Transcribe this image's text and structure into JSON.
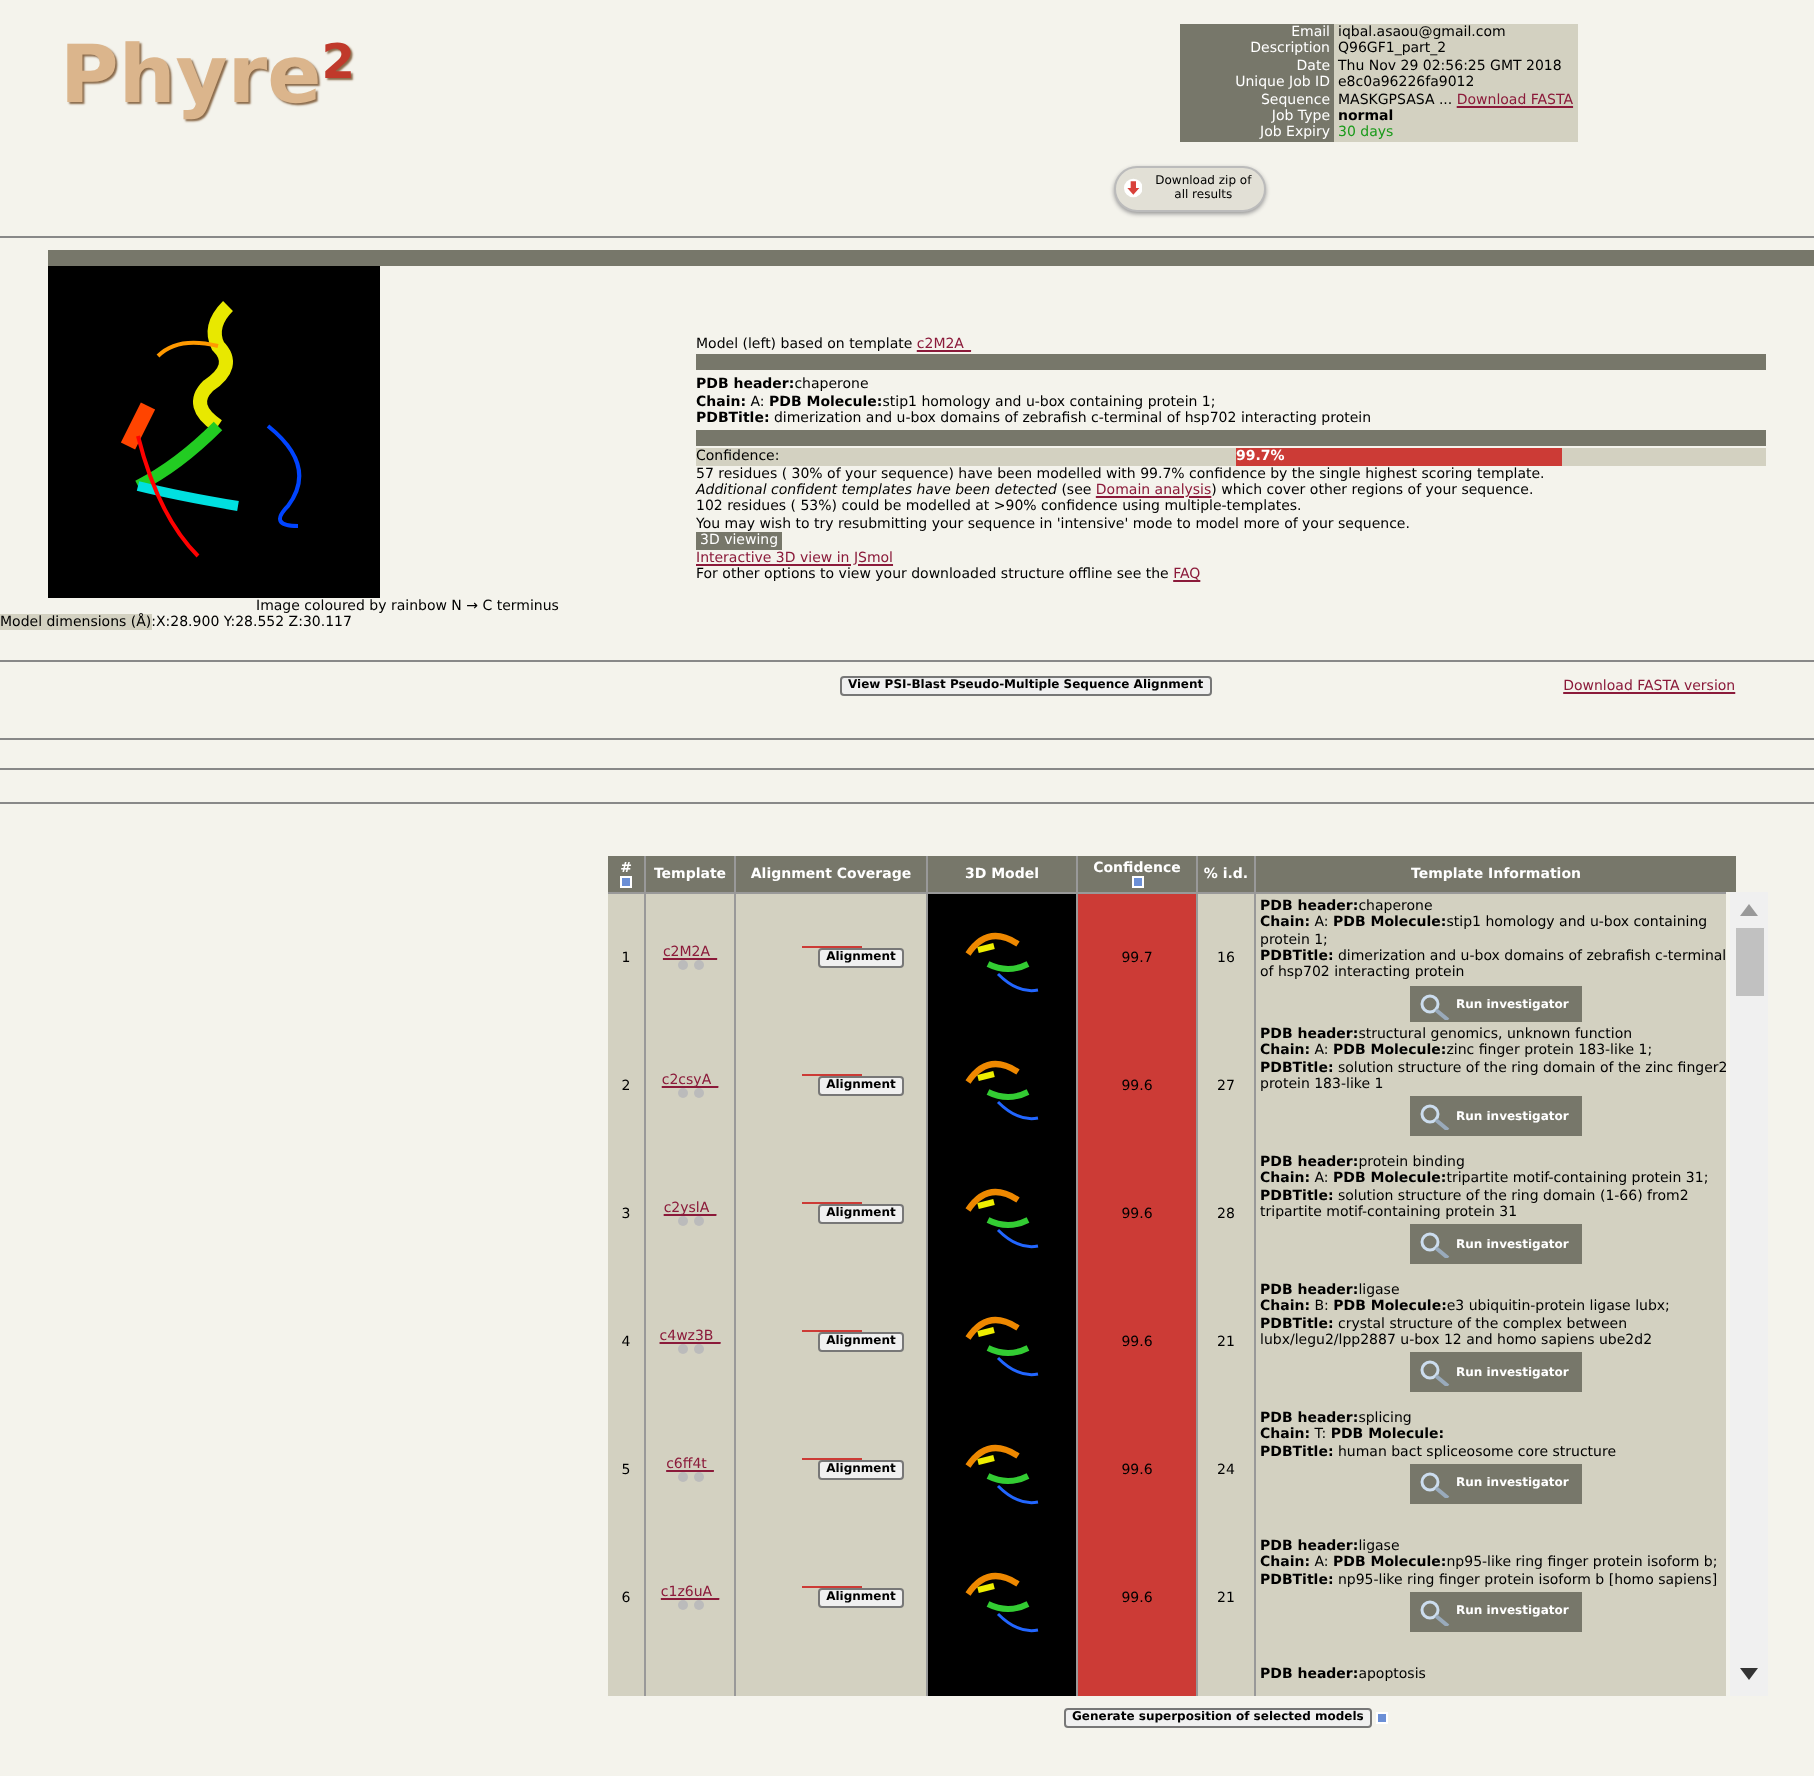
{
  "logo": "Phyre$^{2}$",
  "job_info": [
    {
      "label": "Email",
      "value": "iqbal.asaou@gmail.com",
      "kind": "text"
    },
    {
      "label": "Description",
      "value": "Q96GF1_part_2",
      "kind": "text"
    },
    {
      "label": "Date",
      "value": "Thu Nov 29 02:56:25 GMT 2018",
      "kind": "text"
    },
    {
      "label": "Unique Job ID",
      "value": "e8c0a96226fa9012",
      "kind": "text"
    },
    {
      "label": "Sequence",
      "value": "MASKGPSASA ... ",
      "link": "Download FASTA",
      "kind": "link"
    },
    {
      "label": "Job Type",
      "value": "normal",
      "kind": "bold"
    },
    {
      "label": "Job Expiry",
      "value": "30 days",
      "kind": "good"
    }
  ],
  "download_zip_button": "Download zip of all results",
  "summary": {
    "template_line": "Model (left) based on template ",
    "template_link": "c2M2A_",
    "pdb_header": "**PDB header:**chaperone",
    "chain": "**Chain:** A: **PDB Molecule:**stip1 homology and u-box containing protein 1;",
    "title": "**PDBTitle:** dimerization and u-box domains of zebrafish c-terminal of hsp702 interacting protein",
    "confidence_label": "Confidence:",
    "confidence": "99.7%",
    "level": 0.997,
    "residues": "57 residues ( 30% of your sequence) have been modelled with 99.7% confidence by the single highest scoring template.",
    "additional_before": "*Additional confident templates have been detected* (see ",
    "additional_link": "Domain analysis",
    "additional_after": ") which cover other regions of your sequence.",
    "multi": "102 residues ( 53%) could be modelled at >90% confidence using multiple-templates.",
    "intensive": "You may wish to try resubmitting your sequence in 'intensive' mode to model more of your sequence.",
    "viewing_label": "3D viewing",
    "jsmol_link": "Interactive 3D view in JSmol",
    "offline_text": "For other options to view your downloaded structure offline see the ",
    "faq_link": "FAQ",
    "image_caption": "Image coloured by rainbow N → C terminus",
    "dimensions_label": "Model dimensions (Å)",
    "dimensions": ":X:28.900 Y:28.552 Z:30.117"
  },
  "alignment_button": "View PSI-Blast Pseudo-Multiple Sequence Alignment",
  "fasta_link": "Download FASTA version",
  "table": {
    "columns": [
      "#",
      "Template",
      "Alignment Coverage",
      "3D Model",
      "Confidence",
      "% i.d.",
      "Template Information"
    ],
    "rows": [
      {
        "num": "1",
        "template": "c2M2A_",
        "alignment_label": "Alignment",
        "investigator_label": "Run investigator",
        "confidence": "99.7",
        "identity": "16",
        "pdb_header": "**PDB header:**chaperone",
        "chain": "**Chain:** A: **PDB Molecule:**stip1 homology and u-box containing protein 1;",
        "title": "**PDBTitle:** dimerization and u-box domains of zebrafish c-terminal of hsp702 interacting protein"
      },
      {
        "num": "2",
        "template": "c2csyA_",
        "alignment_label": "Alignment",
        "investigator_label": "Run investigator",
        "confidence": "99.6",
        "identity": "27",
        "pdb_header": "**PDB header:**structural genomics, unknown function",
        "chain": "**Chain:** A: **PDB Molecule:**zinc finger protein 183-like 1;",
        "title": "**PDBTitle:** solution structure of the ring domain of the zinc finger2 protein 183-like 1"
      },
      {
        "num": "3",
        "template": "c2yslA_",
        "alignment_label": "Alignment",
        "investigator_label": "Run investigator",
        "confidence": "99.6",
        "identity": "28",
        "pdb_header": "**PDB header:**protein binding",
        "chain": "**Chain:** A: **PDB Molecule:**tripartite motif-containing protein 31;",
        "title": "**PDBTitle:** solution structure of the ring domain (1-66) from2 tripartite motif-containing protein 31"
      },
      {
        "num": "4",
        "template": "c4wz3B_",
        "alignment_label": "Alignment",
        "investigator_label": "Run investigator",
        "confidence": "99.6",
        "identity": "21",
        "pdb_header": "**PDB header:**ligase",
        "chain": "**Chain:** B: **PDB Molecule:**e3 ubiquitin-protein ligase lubx;",
        "title": "**PDBTitle:** crystal structure of the complex between lubx/legu2/lpp2887 u-box 12 and homo sapiens ube2d2"
      },
      {
        "num": "5",
        "template": "c6ff4t_",
        "alignment_label": "Alignment",
        "investigator_label": "Run investigator",
        "confidence": "99.6",
        "identity": "24",
        "pdb_header": "**PDB header:**splicing",
        "chain": "**Chain:** T: **PDB Molecule:**",
        "title": "**PDBTitle:** human bact spliceosome core structure"
      },
      {
        "num": "6",
        "template": "c1z6uA_",
        "alignment_label": "Alignment",
        "investigator_label": "Run investigator",
        "confidence": "99.6",
        "identity": "21",
        "pdb_header": "**PDB header:**ligase",
        "chain": "**Chain:** A: **PDB Molecule:**np95-like ring finger protein isoform b;",
        "title": "**PDBTitle:** np95-like ring finger protein isoform b [homo sapiens]"
      },
      {
        "pdb_header": "**PDB header:**apoptosis"
      }
    ]
  },
  "superposition_button": "Generate superposition of selected models"
}
